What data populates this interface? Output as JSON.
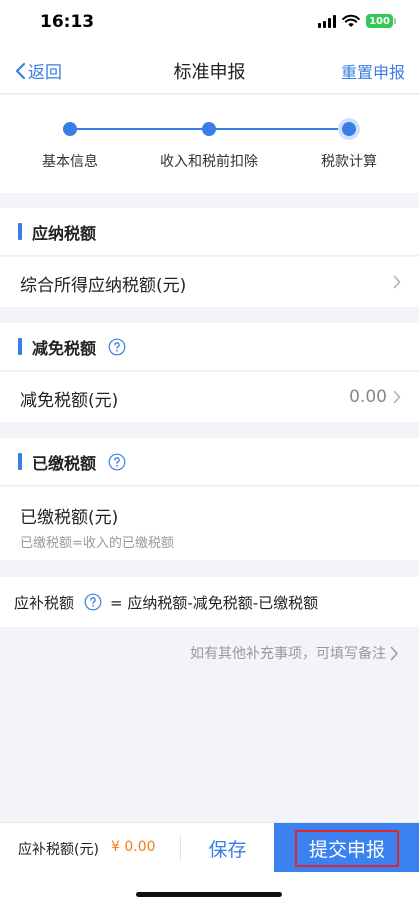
{
  "status_bar": {
    "time": "16:13",
    "battery": "100"
  },
  "nav": {
    "back_label": "返回",
    "title": "标准申报",
    "reset_label": "重置申报"
  },
  "steps": [
    {
      "label": "基本信息"
    },
    {
      "label": "收入和税前扣除"
    },
    {
      "label": "税款计算"
    }
  ],
  "sections": {
    "payable": {
      "title": "应纳税额",
      "row_label": "综合所得应纳税额(元)"
    },
    "reduction": {
      "title": "减免税额",
      "row_label": "减免税额(元)",
      "row_value": "0.00"
    },
    "paid": {
      "title": "已缴税额",
      "row_label": "已缴税额(元)",
      "row_sub": "已缴税额=收入的已缴税额"
    }
  },
  "formula": {
    "label": "应补税额",
    "expression": "= 应纳税额-减免税额-已缴税额"
  },
  "note": "如有其他补充事项，可填写备注",
  "bottom_bar": {
    "label": "应补税额(元)",
    "amount": "¥ 0.00",
    "save_label": "保存",
    "submit_label": "提交申报"
  },
  "colors": {
    "accent": "#3b7de6",
    "amount": "#f07d17",
    "submit_bg": "#3b82f0",
    "highlight_border": "#e0282d"
  },
  "icons": [
    "chevron-left-icon",
    "chevron-right-icon",
    "question-circle-icon",
    "signal-icon",
    "wifi-icon",
    "battery-icon"
  ]
}
